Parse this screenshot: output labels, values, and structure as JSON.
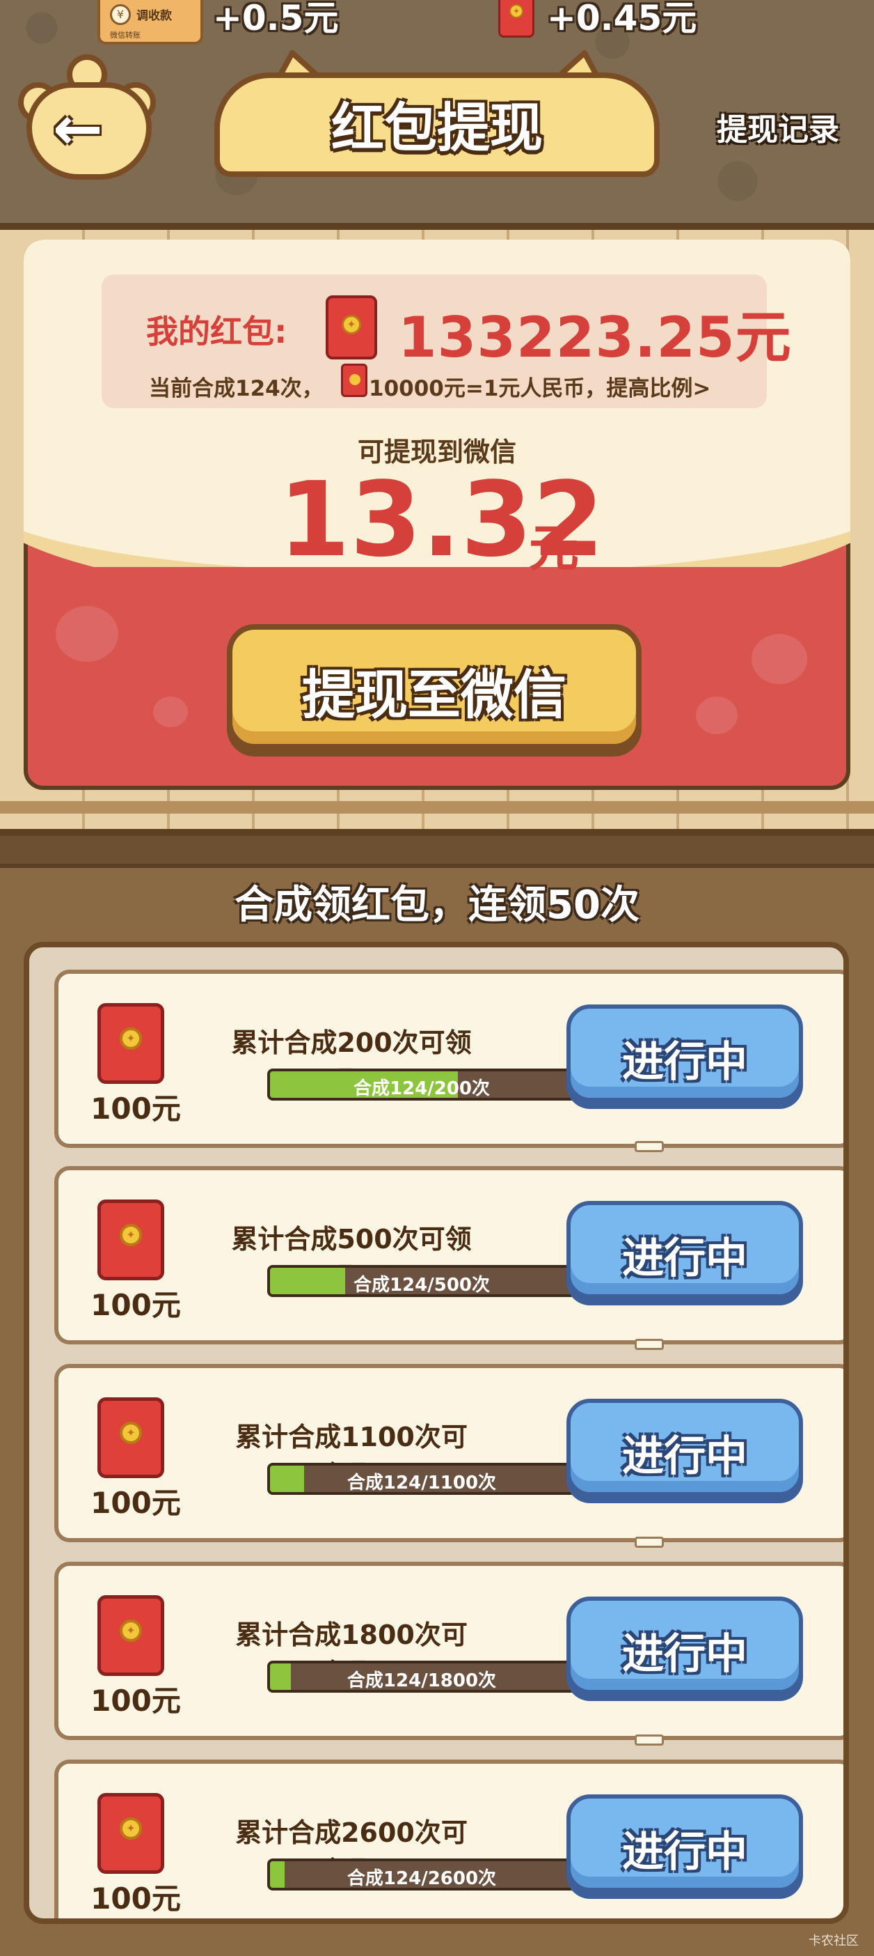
{
  "status_bar": {
    "collect_badge": {
      "title": "调收款",
      "subtitle": "微信转账"
    },
    "amount_left": "+0.5元",
    "amount_right": "+0.45元"
  },
  "header": {
    "title": "红包提现",
    "record_link": "提现记录"
  },
  "envelope_card": {
    "my_label": "我的红包:",
    "balance": "133223.25元",
    "info_left": "当前合成124次，",
    "info_right": "10000元=1元人民币，提高比例>",
    "can_withdraw_label": "可提现到微信",
    "withdraw_amount": "13.32",
    "withdraw_unit": "元",
    "withdraw_button": "提现至微信"
  },
  "tasks_section": {
    "title": "合成领红包，连领50次",
    "tasks": [
      {
        "reward": "100元",
        "desc": "累计合成200次可领取",
        "progress_label": "合成124/200次",
        "progress": 0.62,
        "button": "进行中"
      },
      {
        "reward": "100元",
        "desc": "累计合成500次可领取",
        "progress_label": "合成124/500次",
        "progress": 0.248,
        "button": "进行中"
      },
      {
        "reward": "100元",
        "desc": "累计合成1100次可领取",
        "progress_label": "合成124/1100次",
        "progress": 0.113,
        "button": "进行中"
      },
      {
        "reward": "100元",
        "desc": "累计合成1800次可领取",
        "progress_label": "合成124/1800次",
        "progress": 0.069,
        "button": "进行中"
      },
      {
        "reward": "100元",
        "desc": "累计合成2600次可领取",
        "progress_label": "合成124/2600次",
        "progress": 0.048,
        "button": "进行中"
      }
    ]
  },
  "watermark": "卡农社区",
  "icons": {
    "back": "arrow-left-icon",
    "coin": "coin-icon",
    "red_envelope": "red-envelope-icon"
  },
  "colors": {
    "accent_red": "#d6403a",
    "progress_green": "#8dc53e",
    "button_blue": "#79b8ef",
    "button_gold": "#f3cb5f"
  }
}
